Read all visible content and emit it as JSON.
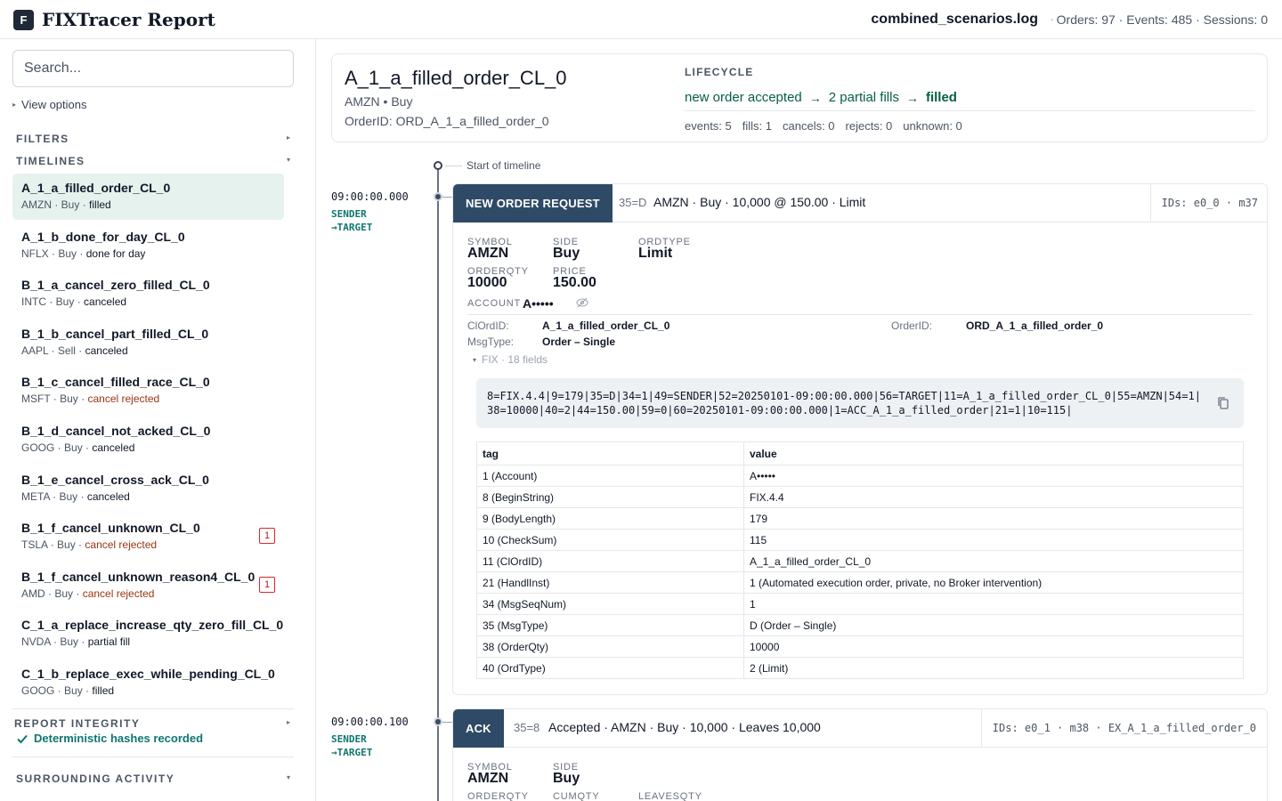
{
  "header": {
    "logo_letter": "F",
    "app_title": "FIXTracer Report",
    "file_name": "combined_scenarios.log",
    "separator": "·",
    "stats": "Orders: 97 · Events: 485 · Sessions: 0"
  },
  "sidebar": {
    "search_placeholder": "Search...",
    "view_options_label": "View options",
    "filters_label": "FILTERS",
    "timelines_label": "TIMELINES",
    "timelines": [
      {
        "name": "A_1_a_filled_order_CL_0",
        "symbol": "AMZN",
        "side": "Buy",
        "status": "filled",
        "badge": ""
      },
      {
        "name": "A_1_b_done_for_day_CL_0",
        "symbol": "NFLX",
        "side": "Buy",
        "status": "done for day",
        "badge": ""
      },
      {
        "name": "B_1_a_cancel_zero_filled_CL_0",
        "symbol": "INTC",
        "side": "Buy",
        "status": "canceled",
        "badge": ""
      },
      {
        "name": "B_1_b_cancel_part_filled_CL_0",
        "symbol": "AAPL",
        "side": "Sell",
        "status": "canceled",
        "badge": ""
      },
      {
        "name": "B_1_c_cancel_filled_race_CL_0",
        "symbol": "MSFT",
        "side": "Buy",
        "status": "cancel rejected",
        "badge": ""
      },
      {
        "name": "B_1_d_cancel_not_acked_CL_0",
        "symbol": "GOOG",
        "side": "Buy",
        "status": "canceled",
        "badge": ""
      },
      {
        "name": "B_1_e_cancel_cross_ack_CL_0",
        "symbol": "META",
        "side": "Buy",
        "status": "canceled",
        "badge": ""
      },
      {
        "name": "B_1_f_cancel_unknown_CL_0",
        "symbol": "TSLA",
        "side": "Buy",
        "status": "cancel rejected",
        "badge": "1"
      },
      {
        "name": "B_1_f_cancel_unknown_reason4_CL_0",
        "symbol": "AMD",
        "side": "Buy",
        "status": "cancel rejected",
        "badge": "1"
      },
      {
        "name": "C_1_a_replace_increase_qty_zero_fill_CL_0",
        "symbol": "NVDA",
        "side": "Buy",
        "status": "partial fill",
        "badge": ""
      },
      {
        "name": "C_1_b_replace_exec_while_pending_CL_0",
        "symbol": "GOOG",
        "side": "Buy",
        "status": "filled",
        "badge": ""
      }
    ],
    "integrity_label": "REPORT INTEGRITY",
    "integrity_status": "Deterministic hashes recorded",
    "surrounding_label": "SURROUNDING ACTIVITY"
  },
  "order": {
    "title": "A_1_a_filled_order_CL_0",
    "subtitle": "AMZN • Buy",
    "order_id": "OrderID:  ORD_A_1_a_filled_order_0",
    "lifecycle_label": "LIFECYCLE",
    "lifecycle_steps": [
      "new order accepted",
      "2 partial fills",
      "filled"
    ],
    "lifecycle_arrow": "→",
    "stats": [
      "events: 5",
      "fills: 1",
      "cancels: 0",
      "rejects: 0",
      "unknown: 0"
    ]
  },
  "timeline": {
    "start_label": "Start of timeline",
    "events": [
      {
        "time": "09:00:00.000",
        "direction_1": "SENDER",
        "direction_2": "→TARGET",
        "type": "NEW ORDER REQUEST",
        "msgtype": "35=D",
        "summary": "AMZN · Buy · 10,000 @ 150.00 · Limit",
        "ids": "IDs: e0_0 · m37",
        "fields": {
          "symbol_label": "SYMBOL",
          "symbol": "AMZN",
          "side_label": "SIDE",
          "side": "Buy",
          "ordtype_label": "ORDTYPE",
          "ordtype": "Limit",
          "orderqty_label": "ORDERQTY",
          "orderqty": "10000",
          "price_label": "PRICE",
          "price": "150.00",
          "account_label": "ACCOUNT",
          "account": "A•••••"
        },
        "clordid_label": "ClOrdID:",
        "clordid": "A_1_a_filled_order_CL_0",
        "orderid_label": "OrderID:",
        "orderid": "ORD_A_1_a_filled_order_0",
        "msgtype_label": "MsgType:",
        "msgtype_value": "Order – Single",
        "fix_toggle": "FIX · 18 fields",
        "raw": "8=FIX.4.4|9=179|35=D|34=1|49=SENDER|52=20250101-09:00:00.000|56=TARGET|11=A_1_a_filled_order_CL_0|55=AMZN|54=1|38=10000|40=2|44=150.00|59=0|60=20250101-09:00:00.000|1=ACC_A_1_a_filled_order|21=1|10=115|",
        "table_headers": [
          "tag",
          "value"
        ],
        "table_rows": [
          [
            "1 (Account)",
            "A•••••"
          ],
          [
            "8 (BeginString)",
            "FIX.4.4"
          ],
          [
            "9 (BodyLength)",
            "179"
          ],
          [
            "10 (CheckSum)",
            "115"
          ],
          [
            "11 (ClOrdID)",
            "A_1_a_filled_order_CL_0"
          ],
          [
            "21 (HandlInst)",
            "1 (Automated execution order, private, no Broker intervention)"
          ],
          [
            "34 (MsgSeqNum)",
            "1"
          ],
          [
            "35 (MsgType)",
            "D (Order – Single)"
          ],
          [
            "38 (OrderQty)",
            "10000"
          ],
          [
            "40 (OrdType)",
            "2 (Limit)"
          ]
        ]
      },
      {
        "time": "09:00:00.100",
        "direction_1": "SENDER",
        "direction_2": "→TARGET",
        "type": "ACK",
        "msgtype": "35=8",
        "summary": "Accepted · AMZN · Buy · 10,000 · Leaves 10,000",
        "ids": "IDs: e0_1 · m38 · EX_A_1_a_filled_order_0",
        "fields": {
          "symbol_label": "SYMBOL",
          "symbol": "AMZN",
          "side_label": "SIDE",
          "side": "Buy",
          "orderqty_label": "ORDERQTY",
          "cumqty_label": "CUMQTY",
          "leavesqty_label": "LEAVESQTY"
        }
      }
    ]
  },
  "colors": {
    "accent_green": "#065f46",
    "event_header_bg": "#2f4a66",
    "selected_bg": "#e6f2ee",
    "badge_red": "#dc2626"
  }
}
